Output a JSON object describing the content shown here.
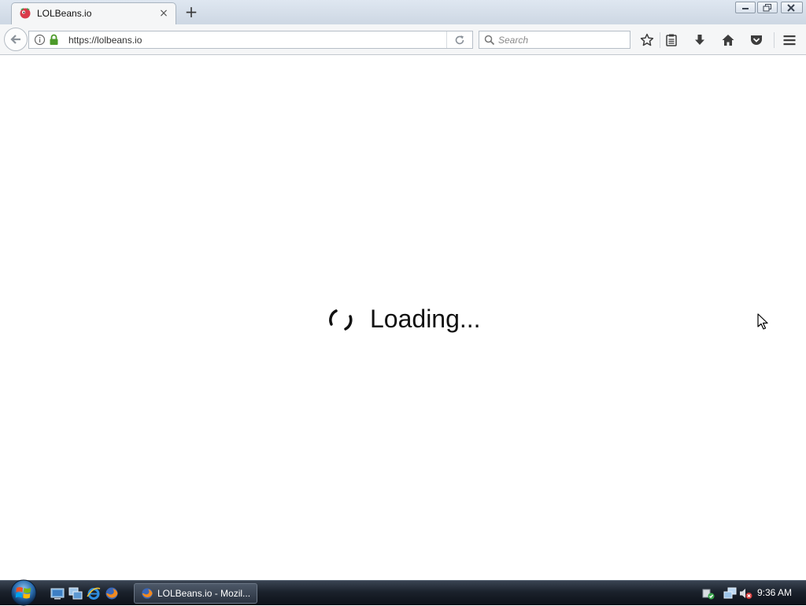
{
  "browser": {
    "tab": {
      "title": "LOLBeans.io",
      "close_glyph": "×"
    },
    "new_tab_glyph": "+",
    "url": "https://lolbeans.io",
    "search_placeholder": "Search"
  },
  "page": {
    "loading_text": "Loading..."
  },
  "taskbar": {
    "task_label": "LOLBeans.io - Mozil...",
    "clock": "9:36 AM"
  },
  "colors": {
    "accent_lock": "#4c9a2a",
    "taskbar_dark": "#1b222c"
  },
  "icons": [
    "tab-favicon-icon",
    "close-icon",
    "plus-icon",
    "minimize-icon",
    "restore-icon",
    "close-window-icon",
    "back-arrow-icon",
    "info-icon",
    "lock-icon",
    "reload-icon",
    "search-icon",
    "bookmark-star-icon",
    "reading-list-icon",
    "download-icon",
    "home-icon",
    "pocket-icon",
    "hamburger-menu-icon",
    "spinner-icon",
    "cursor-icon",
    "windows-start-icon",
    "show-desktop-icon",
    "switch-windows-icon",
    "internet-explorer-icon",
    "firefox-icon",
    "network-icon",
    "volume-muted-icon",
    "action-center-icon"
  ]
}
